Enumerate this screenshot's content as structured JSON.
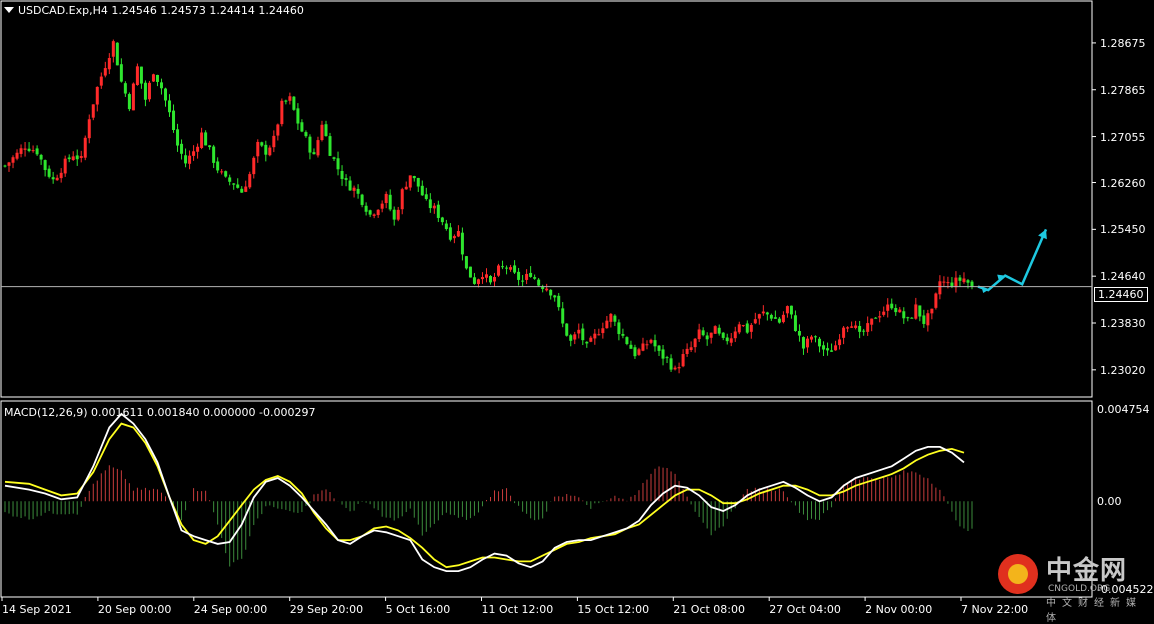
{
  "header": {
    "symbol_line": "USDCAD.Exp,H4  1.24546 1.24573 1.24414 1.24460",
    "macd_line": "MACD(12,26,9) 0.001611 0.001840 0.000000 -0.000297"
  },
  "current_price_label": "1.24460",
  "watermark": {
    "title": "中金网",
    "sub": "CNGOLD.ORG",
    "cn": "中文财经新媒体"
  },
  "colors": {
    "bull": "#ff2a2a",
    "bear": "#2ee62e",
    "macd_main": "#ffffff",
    "macd_signal": "#ffff20",
    "arrow": "#1ec8e0",
    "grid_border": "#ffffff"
  },
  "chart_data": [
    {
      "type": "candlestick",
      "title": "USDCAD.Exp,H4",
      "x_tick_labels": [
        "14 Sep 2021",
        "20 Sep 00:00",
        "24 Sep 00:00",
        "29 Sep 20:00",
        "5 Oct 16:00",
        "11 Oct 12:00",
        "15 Oct 12:00",
        "21 Oct 08:00",
        "27 Oct 04:00",
        "2 Nov 00:00",
        "7 Nov 22:00"
      ],
      "y_tick_labels": [
        "1.28675",
        "1.27865",
        "1.27055",
        "1.26260",
        "1.25450",
        "1.24640",
        "1.23830",
        "1.23020"
      ],
      "ylim": [
        1.2255,
        1.294
      ],
      "current_price": 1.2446,
      "last_bar": {
        "open": 1.24546,
        "high": 1.24573,
        "low": 1.24414,
        "close": 1.2446
      },
      "close_path": [
        [
          0,
          1.2655
        ],
        [
          3,
          1.2675
        ],
        [
          5,
          1.269
        ],
        [
          8,
          1.268
        ],
        [
          10,
          1.265
        ],
        [
          12,
          1.263
        ],
        [
          15,
          1.266
        ],
        [
          17,
          1.2675
        ],
        [
          19,
          1.2665
        ],
        [
          21,
          1.274
        ],
        [
          23,
          1.279
        ],
        [
          25,
          1.283
        ],
        [
          27,
          1.2868
        ],
        [
          29,
          1.28
        ],
        [
          31,
          1.276
        ],
        [
          33,
          1.2825
        ],
        [
          35,
          1.277
        ],
        [
          37,
          1.282
        ],
        [
          39,
          1.279
        ],
        [
          41,
          1.2745
        ],
        [
          43,
          1.269
        ],
        [
          45,
          1.266
        ],
        [
          47,
          1.268
        ],
        [
          49,
          1.271
        ],
        [
          51,
          1.268
        ],
        [
          53,
          1.265
        ],
        [
          55,
          1.263
        ],
        [
          57,
          1.2625
        ],
        [
          59,
          1.261
        ],
        [
          61,
          1.264
        ],
        [
          63,
          1.269
        ],
        [
          65,
          1.268
        ],
        [
          67,
          1.27
        ],
        [
          69,
          1.276
        ],
        [
          71,
          1.277
        ],
        [
          73,
          1.273
        ],
        [
          75,
          1.27
        ],
        [
          77,
          1.267
        ],
        [
          79,
          1.273
        ],
        [
          81,
          1.268
        ],
        [
          83,
          1.265
        ],
        [
          85,
          1.2625
        ],
        [
          87,
          1.2615
        ],
        [
          89,
          1.2595
        ],
        [
          91,
          1.257
        ],
        [
          93,
          1.2585
        ],
        [
          95,
          1.26
        ],
        [
          97,
          1.256
        ],
        [
          99,
          1.261
        ],
        [
          101,
          1.264
        ],
        [
          103,
          1.262
        ],
        [
          105,
          1.259
        ],
        [
          107,
          1.258
        ],
        [
          109,
          1.256
        ],
        [
          111,
          1.2535
        ],
        [
          113,
          1.254
        ],
        [
          115,
          1.2475
        ],
        [
          117,
          1.2455
        ],
        [
          119,
          1.247
        ],
        [
          121,
          1.245
        ],
        [
          123,
          1.2475
        ],
        [
          125,
          1.248
        ],
        [
          127,
          1.2465
        ],
        [
          129,
          1.2455
        ],
        [
          131,
          1.247
        ],
        [
          133,
          1.245
        ],
        [
          135,
          1.2445
        ],
        [
          137,
          1.243
        ],
        [
          139,
          1.238
        ],
        [
          141,
          1.235
        ],
        [
          143,
          1.237
        ],
        [
          145,
          1.234
        ],
        [
          147,
          1.236
        ],
        [
          149,
          1.238
        ],
        [
          151,
          1.2395
        ],
        [
          153,
          1.237
        ],
        [
          155,
          1.235
        ],
        [
          157,
          1.233
        ],
        [
          159,
          1.234
        ],
        [
          161,
          1.2355
        ],
        [
          163,
          1.233
        ],
        [
          165,
          1.232
        ],
        [
          167,
          1.23
        ],
        [
          169,
          1.2325
        ],
        [
          171,
          1.234
        ],
        [
          173,
          1.2365
        ],
        [
          175,
          1.2355
        ],
        [
          177,
          1.237
        ],
        [
          179,
          1.235
        ],
        [
          181,
          1.236
        ],
        [
          183,
          1.2385
        ],
        [
          185,
          1.237
        ],
        [
          187,
          1.239
        ],
        [
          189,
          1.24
        ],
        [
          191,
          1.2395
        ],
        [
          193,
          1.2385
        ],
        [
          195,
          1.241
        ],
        [
          197,
          1.2375
        ],
        [
          199,
          1.234
        ],
        [
          201,
          1.236
        ],
        [
          203,
          1.2345
        ],
        [
          205,
          1.233
        ],
        [
          207,
          1.2345
        ],
        [
          209,
          1.238
        ],
        [
          211,
          1.2385
        ],
        [
          213,
          1.236
        ],
        [
          215,
          1.2375
        ],
        [
          217,
          1.2395
        ],
        [
          219,
          1.2405
        ],
        [
          221,
          1.2415
        ],
        [
          223,
          1.24
        ],
        [
          225,
          1.2385
        ],
        [
          227,
          1.241
        ],
        [
          229,
          1.2385
        ],
        [
          231,
          1.24
        ],
        [
          233,
          1.2455
        ],
        [
          235,
          1.245
        ],
        [
          237,
          1.2455
        ],
        [
          239,
          1.246
        ],
        [
          241,
          1.2446
        ]
      ],
      "forecast_arrow": [
        [
          1.2446,
          0
        ],
        [
          1.244,
          3
        ],
        [
          1.2465,
          8
        ],
        [
          1.245,
          13
        ],
        [
          1.2545,
          20
        ]
      ]
    },
    {
      "type": "line",
      "title": "MACD(12,26,9)",
      "values": {
        "main": 0.001611,
        "signal": 0.00184,
        "extra": 0.0,
        "hist": -0.000297
      },
      "y_tick_labels": [
        "0.004754",
        "0.00",
        "-0.004522"
      ],
      "ylim": [
        -0.004522,
        0.004754
      ],
      "series": [
        {
          "key": "macd",
          "points": [
            [
              0,
              0.0008
            ],
            [
              6,
              0.0006
            ],
            [
              10,
              0.0004
            ],
            [
              14,
              0.0001
            ],
            [
              18,
              0.0002
            ],
            [
              22,
              0.0018
            ],
            [
              26,
              0.0038
            ],
            [
              29,
              0.0045
            ],
            [
              32,
              0.004
            ],
            [
              35,
              0.0032
            ],
            [
              38,
              0.002
            ],
            [
              41,
              0.0002
            ],
            [
              44,
              -0.0015
            ],
            [
              47,
              -0.0018
            ],
            [
              50,
              -0.002
            ],
            [
              53,
              -0.0022
            ],
            [
              56,
              -0.0021
            ],
            [
              59,
              -0.0012
            ],
            [
              62,
              0.0002
            ],
            [
              65,
              0.001
            ],
            [
              68,
              0.0012
            ],
            [
              71,
              0.0008
            ],
            [
              74,
              0.0002
            ],
            [
              77,
              -0.0005
            ],
            [
              80,
              -0.0012
            ],
            [
              83,
              -0.002
            ],
            [
              86,
              -0.0022
            ],
            [
              89,
              -0.0018
            ],
            [
              92,
              -0.0015
            ],
            [
              95,
              -0.0016
            ],
            [
              98,
              -0.0018
            ],
            [
              101,
              -0.002
            ],
            [
              104,
              -0.003
            ],
            [
              107,
              -0.0034
            ],
            [
              110,
              -0.0036
            ],
            [
              113,
              -0.0036
            ],
            [
              116,
              -0.0034
            ],
            [
              119,
              -0.003
            ],
            [
              122,
              -0.0027
            ],
            [
              125,
              -0.0028
            ],
            [
              128,
              -0.0032
            ],
            [
              131,
              -0.0034
            ],
            [
              134,
              -0.0031
            ],
            [
              137,
              -0.0024
            ],
            [
              140,
              -0.0021
            ],
            [
              143,
              -0.002
            ],
            [
              146,
              -0.002
            ],
            [
              149,
              -0.0018
            ],
            [
              152,
              -0.0016
            ],
            [
              155,
              -0.0014
            ],
            [
              158,
              -0.001
            ],
            [
              161,
              -0.0002
            ],
            [
              164,
              0.0004
            ],
            [
              167,
              0.0008
            ],
            [
              170,
              0.0007
            ],
            [
              173,
              0.0003
            ],
            [
              176,
              -0.0003
            ],
            [
              179,
              -0.0005
            ],
            [
              182,
              -0.0002
            ],
            [
              185,
              0.0003
            ],
            [
              188,
              0.0006
            ],
            [
              191,
              0.0008
            ],
            [
              194,
              0.001
            ],
            [
              197,
              0.0007
            ],
            [
              200,
              0.0003
            ],
            [
              203,
              0.0
            ],
            [
              206,
              0.0002
            ],
            [
              209,
              0.0008
            ],
            [
              212,
              0.0012
            ],
            [
              215,
              0.0014
            ],
            [
              218,
              0.0016
            ],
            [
              221,
              0.0018
            ],
            [
              224,
              0.0022
            ],
            [
              227,
              0.0026
            ],
            [
              230,
              0.0028
            ],
            [
              233,
              0.0028
            ],
            [
              236,
              0.0025
            ],
            [
              239,
              0.002
            ]
          ]
        },
        {
          "key": "signal",
          "points": [
            [
              0,
              0.001
            ],
            [
              6,
              0.0009
            ],
            [
              10,
              0.0006
            ],
            [
              14,
              0.0003
            ],
            [
              18,
              0.0004
            ],
            [
              22,
              0.0015
            ],
            [
              26,
              0.0032
            ],
            [
              29,
              0.004
            ],
            [
              32,
              0.0038
            ],
            [
              35,
              0.003
            ],
            [
              38,
              0.0018
            ],
            [
              41,
              0.0002
            ],
            [
              44,
              -0.0012
            ],
            [
              47,
              -0.002
            ],
            [
              50,
              -0.0022
            ],
            [
              53,
              -0.0018
            ],
            [
              56,
              -0.001
            ],
            [
              59,
              -0.0002
            ],
            [
              62,
              0.0006
            ],
            [
              65,
              0.0011
            ],
            [
              68,
              0.0013
            ],
            [
              71,
              0.001
            ],
            [
              74,
              0.0004
            ],
            [
              77,
              -0.0006
            ],
            [
              80,
              -0.0014
            ],
            [
              83,
              -0.002
            ],
            [
              86,
              -0.002
            ],
            [
              89,
              -0.0018
            ],
            [
              92,
              -0.0014
            ],
            [
              95,
              -0.0013
            ],
            [
              98,
              -0.0015
            ],
            [
              101,
              -0.0019
            ],
            [
              104,
              -0.0024
            ],
            [
              107,
              -0.003
            ],
            [
              110,
              -0.0034
            ],
            [
              113,
              -0.0033
            ],
            [
              116,
              -0.0031
            ],
            [
              119,
              -0.0029
            ],
            [
              122,
              -0.0029
            ],
            [
              125,
              -0.003
            ],
            [
              128,
              -0.0031
            ],
            [
              131,
              -0.0031
            ],
            [
              134,
              -0.0028
            ],
            [
              137,
              -0.0025
            ],
            [
              140,
              -0.0022
            ],
            [
              143,
              -0.0021
            ],
            [
              146,
              -0.0019
            ],
            [
              149,
              -0.0018
            ],
            [
              152,
              -0.0017
            ],
            [
              155,
              -0.0014
            ],
            [
              158,
              -0.0012
            ],
            [
              161,
              -0.0007
            ],
            [
              164,
              -0.0002
            ],
            [
              167,
              0.0003
            ],
            [
              170,
              0.0006
            ],
            [
              173,
              0.0006
            ],
            [
              176,
              0.0003
            ],
            [
              179,
              -0.0001
            ],
            [
              182,
              -0.0001
            ],
            [
              185,
              0.0001
            ],
            [
              188,
              0.0004
            ],
            [
              191,
              0.0006
            ],
            [
              194,
              0.0008
            ],
            [
              197,
              0.0008
            ],
            [
              200,
              0.0006
            ],
            [
              203,
              0.0003
            ],
            [
              206,
              0.0003
            ],
            [
              209,
              0.0005
            ],
            [
              212,
              0.0008
            ],
            [
              215,
              0.001
            ],
            [
              218,
              0.0012
            ],
            [
              221,
              0.0014
            ],
            [
              224,
              0.0017
            ],
            [
              227,
              0.0021
            ],
            [
              230,
              0.0024
            ],
            [
              233,
              0.0026
            ],
            [
              236,
              0.0027
            ],
            [
              239,
              0.0025
            ]
          ]
        }
      ]
    }
  ]
}
